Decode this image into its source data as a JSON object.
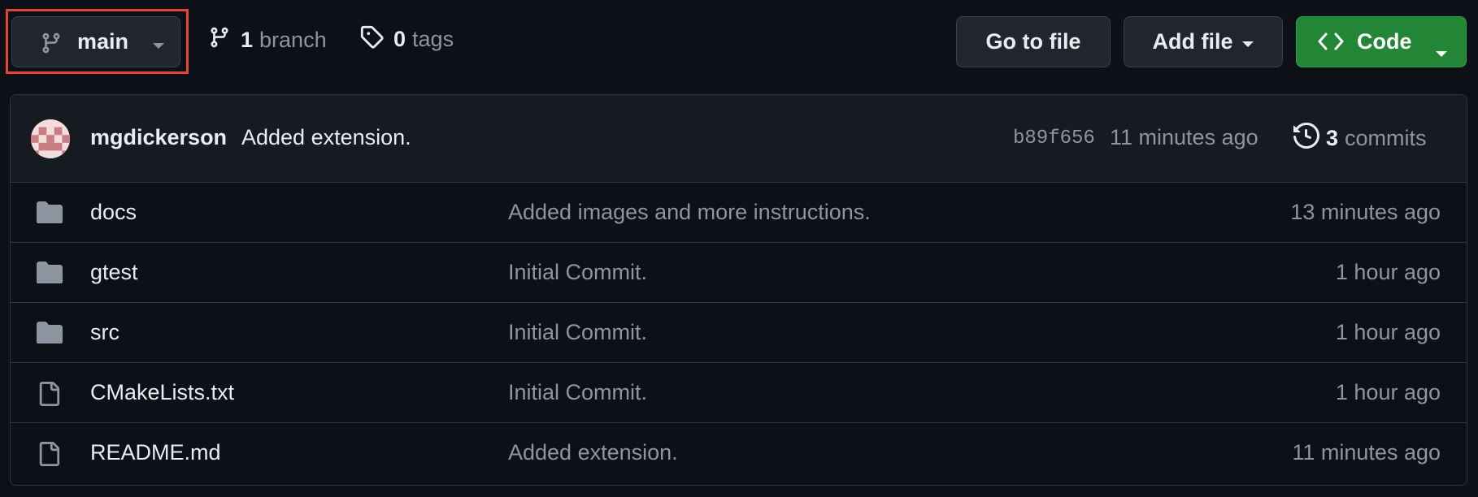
{
  "toolbar": {
    "branch_selector": {
      "label": "main",
      "icon": "git-branch-icon"
    },
    "branches": {
      "count": "1",
      "label": "branch"
    },
    "tags": {
      "count": "0",
      "label": "tags"
    },
    "go_to_file_label": "Go to file",
    "add_file_label": "Add file",
    "code_label": "Code",
    "highlight_color": "#e5452e"
  },
  "latest_commit": {
    "author": "mgdickerson",
    "message": "Added extension.",
    "sha": "b89f656",
    "time": "11 minutes ago",
    "commits_count": "3",
    "commits_label": "commits"
  },
  "files": [
    {
      "type": "folder",
      "name": "docs",
      "message": "Added images and more instructions.",
      "time": "13 minutes ago"
    },
    {
      "type": "folder",
      "name": "gtest",
      "message": "Initial Commit.",
      "time": "1 hour ago"
    },
    {
      "type": "folder",
      "name": "src",
      "message": "Initial Commit.",
      "time": "1 hour ago"
    },
    {
      "type": "file",
      "name": "CMakeLists.txt",
      "message": "Initial Commit.",
      "time": "1 hour ago"
    },
    {
      "type": "file",
      "name": "README.md",
      "message": "Added extension.",
      "time": "11 minutes ago"
    }
  ],
  "colors": {
    "background": "#0d1117",
    "code_button": "#238636",
    "muted_text": "#8d96a0"
  }
}
